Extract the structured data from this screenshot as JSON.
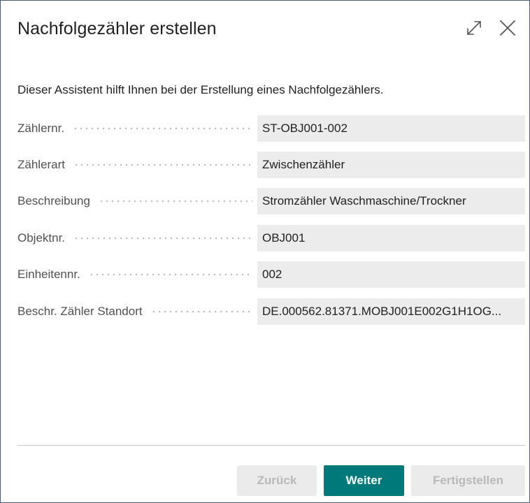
{
  "dialog": {
    "title": "Nachfolgezähler erstellen",
    "intro": "Dieser Assistent hilft Ihnen bei der Erstellung eines Nachfolgezählers.",
    "expand_icon": "expand-icon",
    "close_icon": "close-icon"
  },
  "fields": [
    {
      "label": "Zählernr.",
      "value": "ST-OBJ001-002"
    },
    {
      "label": "Zählerart",
      "value": "Zwischenzähler"
    },
    {
      "label": "Beschreibung",
      "value": "Stromzähler Waschmaschine/Trockner"
    },
    {
      "label": "Objektnr.",
      "value": "OBJ001"
    },
    {
      "label": "Einheitennr.",
      "value": "002"
    },
    {
      "label": "Beschr. Zähler Standort",
      "value": "DE.000562.81371.MOBJ001E002G1H1OG..."
    }
  ],
  "buttons": {
    "back": "Zurück",
    "next": "Weiter",
    "finish": "Fertigstellen"
  },
  "colors": {
    "primary": "#00797a",
    "field_background": "#ececec",
    "disabled_button": "#ebebeb"
  }
}
